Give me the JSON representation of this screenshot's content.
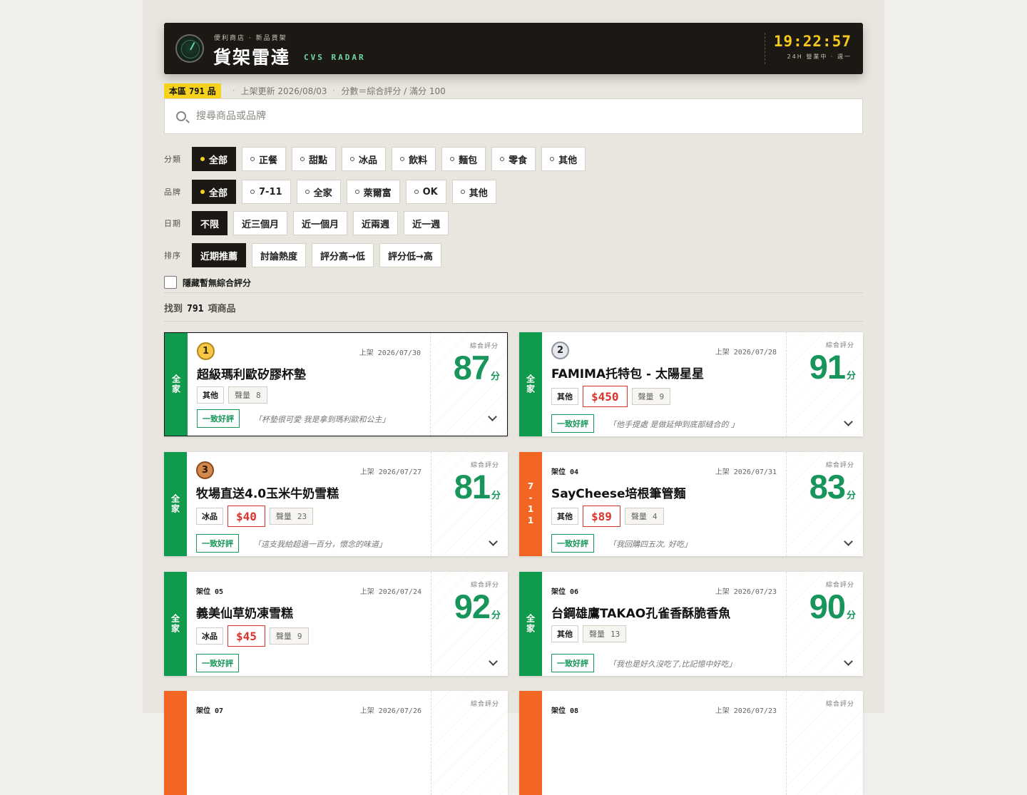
{
  "header": {
    "subtitle": "便利商店 · 新品貨架",
    "title": "貨架雷達",
    "title_en": "CVS RADAR",
    "clock": "19:22:57",
    "clock_sub": "24H 營業中 · 週一"
  },
  "meta": {
    "badge_prefix": "本區",
    "count": "791",
    "badge_suffix": "品",
    "updated": "上架更新 2026/08/03",
    "score_note": "分數＝綜合評分 / 滿分 100"
  },
  "search": {
    "placeholder": "搜尋商品或品牌"
  },
  "filters": {
    "category": {
      "label": "分類",
      "options": [
        "全部",
        "正餐",
        "甜點",
        "冰品",
        "飲料",
        "麵包",
        "零食",
        "其他"
      ],
      "selected": "全部"
    },
    "brand": {
      "label": "品牌",
      "options": [
        "全部",
        "7-11",
        "全家",
        "萊爾富",
        "OK",
        "其他"
      ],
      "selected": "全部"
    },
    "date": {
      "label": "日期",
      "options": [
        "不限",
        "近三個月",
        "近一個月",
        "近兩週",
        "近一週"
      ],
      "selected": "不限"
    },
    "sort": {
      "label": "排序",
      "options": [
        "近期推薦",
        "討論熱度",
        "評分高→低",
        "評分低→高"
      ],
      "selected": "近期推薦"
    }
  },
  "hide_unrated": {
    "label": "隱藏暫無綜合評分",
    "checked": false
  },
  "results": {
    "prefix": "找到",
    "count": "791",
    "suffix": "項商品"
  },
  "labels": {
    "score_label": "綜合評分",
    "score_unit": "分",
    "volume_label": "聲量",
    "listed_prefix": "上架"
  },
  "products": [
    {
      "rank": "1",
      "medal": "gold",
      "slot": "",
      "brand": "全家",
      "brand_color": "#0f9a4d",
      "date": "2026/07/30",
      "name": "超級瑪利歐矽膠杯墊",
      "category": "其他",
      "price": "",
      "volume": "8",
      "verdict": "一致好評",
      "quote": "「杯墊很可愛 我是拿到瑪利歐和公主」",
      "score": "87",
      "selected": true
    },
    {
      "rank": "2",
      "medal": "silver",
      "slot": "",
      "brand": "全家",
      "brand_color": "#0f9a4d",
      "date": "2026/07/28",
      "name": "FAMIMA托特包 - 太陽星星",
      "category": "其他",
      "price": "$450",
      "volume": "9",
      "verdict": "一致好評",
      "quote": "「他手提處 是做延伸到底部縫合的 」",
      "score": "91"
    },
    {
      "rank": "3",
      "medal": "bronze",
      "slot": "",
      "brand": "全家",
      "brand_color": "#0f9a4d",
      "date": "2026/07/27",
      "name": "牧場直送4.0玉米牛奶雪糕",
      "category": "冰品",
      "price": "$40",
      "volume": "23",
      "verdict": "一致好評",
      "quote": "「這支我給超過一百分，懷念的味道」",
      "score": "81"
    },
    {
      "rank": "",
      "medal": "",
      "slot": "架位 04",
      "brand": "7-11",
      "brand_color": "#f26522",
      "date": "2026/07/31",
      "name": "SayCheese培根筆管麵",
      "category": "其他",
      "price": "$89",
      "volume": "4",
      "verdict": "一致好評",
      "quote": "「我回購四五次, 好吃」",
      "score": "83"
    },
    {
      "rank": "",
      "medal": "",
      "slot": "架位 05",
      "brand": "全家",
      "brand_color": "#0f9a4d",
      "date": "2026/07/24",
      "name": "義美仙草奶凍雪糕",
      "category": "冰品",
      "price": "$45",
      "volume": "9",
      "verdict": "一致好評",
      "quote": "",
      "score": "92"
    },
    {
      "rank": "",
      "medal": "",
      "slot": "架位 06",
      "brand": "全家",
      "brand_color": "#0f9a4d",
      "date": "2026/07/23",
      "name": "台鋼雄鷹TAKAO孔雀香酥脆香魚",
      "category": "其他",
      "price": "",
      "volume": "13",
      "verdict": "一致好評",
      "quote": "「我也是好久沒吃了,比記憶中好吃」",
      "score": "90"
    },
    {
      "rank": "",
      "medal": "",
      "slot": "架位 07",
      "brand": "",
      "brand_color": "#f26522",
      "date": "2026/07/26",
      "name": "",
      "category": "",
      "price": "",
      "volume": "",
      "verdict": "",
      "quote": "",
      "score": ""
    },
    {
      "rank": "",
      "medal": "",
      "slot": "架位 08",
      "brand": "",
      "brand_color": "#f26522",
      "date": "2026/07/23",
      "name": "",
      "category": "",
      "price": "",
      "volume": "",
      "verdict": "",
      "quote": "",
      "score": ""
    }
  ]
}
